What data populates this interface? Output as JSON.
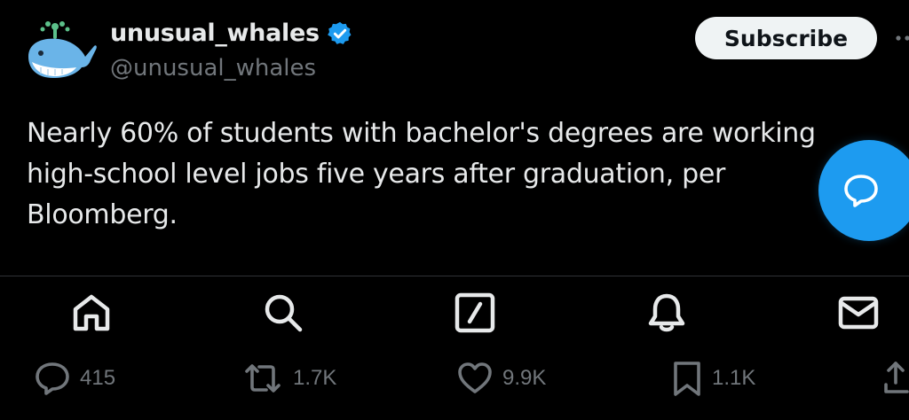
{
  "tweet": {
    "author": {
      "display_name": "unusual_whales",
      "handle": "@unusual_whales",
      "verified": true,
      "avatar_icon": "whale-emoji-icon"
    },
    "subscribe_label": "Subscribe",
    "text": "Nearly 60% of students with bachelor's degrees are working\nhigh-school level jobs five years after graduation, per\nBloomberg."
  },
  "bottom_nav": {
    "items": [
      {
        "icon": "home-icon"
      },
      {
        "icon": "search-icon"
      },
      {
        "icon": "grok-icon"
      },
      {
        "icon": "notifications-bell-icon"
      },
      {
        "icon": "messages-envelope-icon"
      }
    ]
  },
  "actions": {
    "replies": "415",
    "reposts": "1.7K",
    "likes": "9.9K",
    "bookmarks": "1.1K"
  },
  "colors": {
    "background": "#000000",
    "text": "#e7e9ea",
    "secondary_text": "#71767b",
    "accent": "#1d9bf0",
    "divider": "#2f3336"
  }
}
